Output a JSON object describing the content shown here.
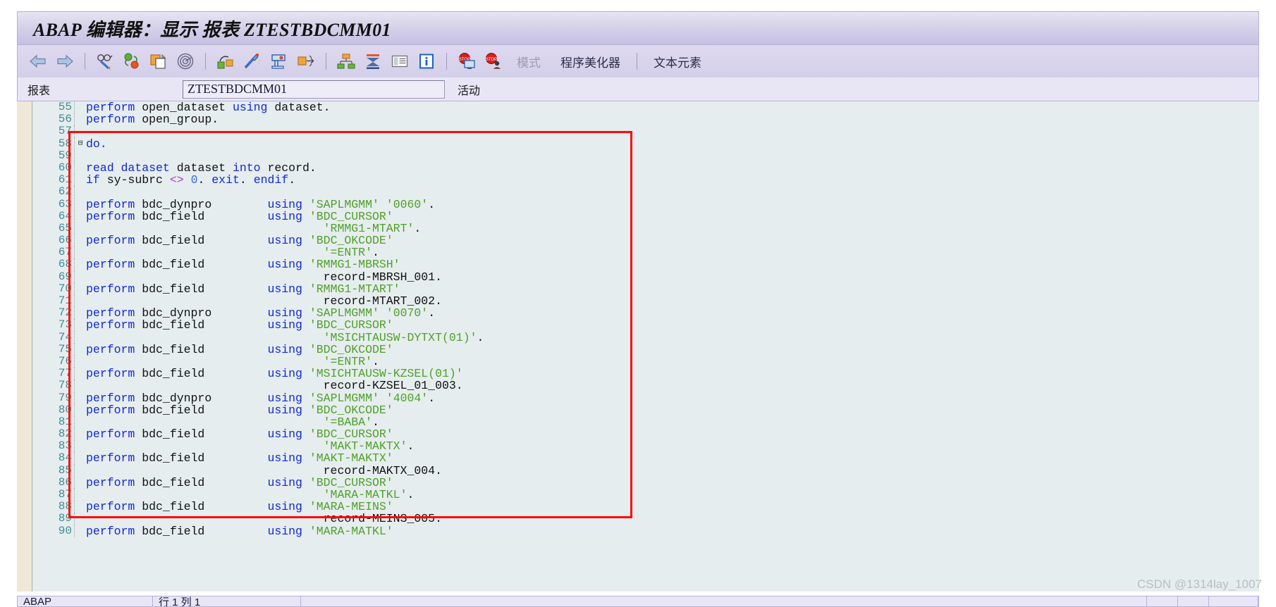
{
  "window": {
    "title": "ABAP 编辑器：显示 报表 ZTESTBDCMM01"
  },
  "toolbar": {
    "icons": [
      {
        "name": "back-arrow-icon",
        "label": "后退"
      },
      {
        "name": "forward-arrow-icon",
        "label": "前进"
      },
      {
        "name": "display-change-icon",
        "label": "显示<->修改"
      },
      {
        "name": "activate-icon",
        "label": "激活"
      },
      {
        "name": "copy-icon",
        "label": "复制"
      },
      {
        "name": "where-used-icon",
        "label": "使用位置"
      },
      {
        "name": "check-icon",
        "label": "检查"
      },
      {
        "name": "pretty-printer-icon",
        "label": "美化"
      },
      {
        "name": "pattern-icon",
        "label": "模式"
      },
      {
        "name": "insert-statement-icon",
        "label": "插入语句"
      },
      {
        "name": "object-navigator-icon",
        "label": "对象浏览器"
      },
      {
        "name": "stack-icon",
        "label": "堆栈"
      },
      {
        "name": "list-icon",
        "label": "列表"
      },
      {
        "name": "info-icon",
        "label": "信息"
      },
      {
        "name": "debug-screen-icon",
        "label": "调试"
      },
      {
        "name": "debug-user-icon",
        "label": "调试用户"
      }
    ],
    "mode_label": "模式",
    "pretty_printer_label": "程序美化器",
    "text_elements_label": "文本元素"
  },
  "report_row": {
    "label": "报表",
    "value": "ZTESTBDCMM01",
    "status": "活动"
  },
  "statusbar": {
    "language": "ABAP",
    "position": "行 1 列 1",
    "cell1": "",
    "cell2": "",
    "cell3": ""
  },
  "watermark": "CSDN @1314lay_1007",
  "editor": {
    "first_line": 55,
    "lines": [
      {
        "n": 55,
        "fold": "",
        "tokens": [
          {
            "t": "perform ",
            "c": "kw"
          },
          {
            "t": "open_dataset ",
            "c": "id"
          },
          {
            "t": "using ",
            "c": "kw"
          },
          {
            "t": "dataset.",
            "c": "id"
          }
        ]
      },
      {
        "n": 56,
        "fold": "",
        "tokens": [
          {
            "t": "perform ",
            "c": "kw"
          },
          {
            "t": "open_group.",
            "c": "id"
          }
        ]
      },
      {
        "n": 57,
        "fold": "",
        "tokens": []
      },
      {
        "n": 58,
        "fold": "⊟",
        "tokens": [
          {
            "t": "do.",
            "c": "kw"
          }
        ]
      },
      {
        "n": 59,
        "fold": "",
        "tokens": []
      },
      {
        "n": 60,
        "fold": "",
        "tokens": [
          {
            "t": "read dataset ",
            "c": "kw"
          },
          {
            "t": "dataset ",
            "c": "id"
          },
          {
            "t": "into ",
            "c": "kw"
          },
          {
            "t": "record.",
            "c": "id"
          }
        ]
      },
      {
        "n": 61,
        "fold": "",
        "tokens": [
          {
            "t": "if ",
            "c": "kw"
          },
          {
            "t": "sy-subrc ",
            "c": "id"
          },
          {
            "t": "<> ",
            "c": "op"
          },
          {
            "t": "0",
            "c": "num"
          },
          {
            "t": ". ",
            "c": "id"
          },
          {
            "t": "exit",
            "c": "kw"
          },
          {
            "t": ". ",
            "c": "id"
          },
          {
            "t": "endif",
            "c": "kw"
          },
          {
            "t": ".",
            "c": "id"
          }
        ]
      },
      {
        "n": 62,
        "fold": "",
        "tokens": []
      },
      {
        "n": 63,
        "fold": "",
        "tokens": [
          {
            "t": "perform ",
            "c": "kw"
          },
          {
            "t": "bdc_dynpro        ",
            "c": "id"
          },
          {
            "t": "using ",
            "c": "kw"
          },
          {
            "t": "'SAPLMGMM' '0060'",
            "c": "str"
          },
          {
            "t": ".",
            "c": "id"
          }
        ]
      },
      {
        "n": 64,
        "fold": "",
        "tokens": [
          {
            "t": "perform ",
            "c": "kw"
          },
          {
            "t": "bdc_field         ",
            "c": "id"
          },
          {
            "t": "using ",
            "c": "kw"
          },
          {
            "t": "'BDC_CURSOR'",
            "c": "str"
          }
        ]
      },
      {
        "n": 65,
        "fold": "",
        "tokens": [
          {
            "t": "                                  ",
            "c": "id"
          },
          {
            "t": "'RMMG1-MTART'",
            "c": "str"
          },
          {
            "t": ".",
            "c": "id"
          }
        ]
      },
      {
        "n": 66,
        "fold": "",
        "tokens": [
          {
            "t": "perform ",
            "c": "kw"
          },
          {
            "t": "bdc_field         ",
            "c": "id"
          },
          {
            "t": "using ",
            "c": "kw"
          },
          {
            "t": "'BDC_OKCODE'",
            "c": "str"
          }
        ]
      },
      {
        "n": 67,
        "fold": "",
        "tokens": [
          {
            "t": "                                  ",
            "c": "id"
          },
          {
            "t": "'=ENTR'",
            "c": "str"
          },
          {
            "t": ".",
            "c": "id"
          }
        ]
      },
      {
        "n": 68,
        "fold": "",
        "tokens": [
          {
            "t": "perform ",
            "c": "kw"
          },
          {
            "t": "bdc_field         ",
            "c": "id"
          },
          {
            "t": "using ",
            "c": "kw"
          },
          {
            "t": "'RMMG1-MBRSH'",
            "c": "str"
          }
        ]
      },
      {
        "n": 69,
        "fold": "",
        "tokens": [
          {
            "t": "                                  record-MBRSH_001.",
            "c": "id"
          }
        ]
      },
      {
        "n": 70,
        "fold": "",
        "tokens": [
          {
            "t": "perform ",
            "c": "kw"
          },
          {
            "t": "bdc_field         ",
            "c": "id"
          },
          {
            "t": "using ",
            "c": "kw"
          },
          {
            "t": "'RMMG1-MTART'",
            "c": "str"
          }
        ]
      },
      {
        "n": 71,
        "fold": "",
        "tokens": [
          {
            "t": "                                  record-MTART_002.",
            "c": "id"
          }
        ]
      },
      {
        "n": 72,
        "fold": "",
        "tokens": [
          {
            "t": "perform ",
            "c": "kw"
          },
          {
            "t": "bdc_dynpro        ",
            "c": "id"
          },
          {
            "t": "using ",
            "c": "kw"
          },
          {
            "t": "'SAPLMGMM' '0070'",
            "c": "str"
          },
          {
            "t": ".",
            "c": "id"
          }
        ]
      },
      {
        "n": 73,
        "fold": "",
        "tokens": [
          {
            "t": "perform ",
            "c": "kw"
          },
          {
            "t": "bdc_field         ",
            "c": "id"
          },
          {
            "t": "using ",
            "c": "kw"
          },
          {
            "t": "'BDC_CURSOR'",
            "c": "str"
          }
        ]
      },
      {
        "n": 74,
        "fold": "",
        "tokens": [
          {
            "t": "                                  ",
            "c": "id"
          },
          {
            "t": "'MSICHTAUSW-DYTXT(01)'",
            "c": "str"
          },
          {
            "t": ".",
            "c": "id"
          }
        ]
      },
      {
        "n": 75,
        "fold": "",
        "tokens": [
          {
            "t": "perform ",
            "c": "kw"
          },
          {
            "t": "bdc_field         ",
            "c": "id"
          },
          {
            "t": "using ",
            "c": "kw"
          },
          {
            "t": "'BDC_OKCODE'",
            "c": "str"
          }
        ]
      },
      {
        "n": 76,
        "fold": "",
        "tokens": [
          {
            "t": "                                  ",
            "c": "id"
          },
          {
            "t": "'=ENTR'",
            "c": "str"
          },
          {
            "t": ".",
            "c": "id"
          }
        ]
      },
      {
        "n": 77,
        "fold": "",
        "tokens": [
          {
            "t": "perform ",
            "c": "kw"
          },
          {
            "t": "bdc_field         ",
            "c": "id"
          },
          {
            "t": "using ",
            "c": "kw"
          },
          {
            "t": "'MSICHTAUSW-KZSEL(01)'",
            "c": "str"
          }
        ]
      },
      {
        "n": 78,
        "fold": "",
        "tokens": [
          {
            "t": "                                  record-KZSEL_01_003.",
            "c": "id"
          }
        ]
      },
      {
        "n": 79,
        "fold": "",
        "tokens": [
          {
            "t": "perform ",
            "c": "kw"
          },
          {
            "t": "bdc_dynpro        ",
            "c": "id"
          },
          {
            "t": "using ",
            "c": "kw"
          },
          {
            "t": "'SAPLMGMM' '4004'",
            "c": "str"
          },
          {
            "t": ".",
            "c": "id"
          }
        ]
      },
      {
        "n": 80,
        "fold": "",
        "tokens": [
          {
            "t": "perform ",
            "c": "kw"
          },
          {
            "t": "bdc_field         ",
            "c": "id"
          },
          {
            "t": "using ",
            "c": "kw"
          },
          {
            "t": "'BDC_OKCODE'",
            "c": "str"
          }
        ]
      },
      {
        "n": 81,
        "fold": "",
        "tokens": [
          {
            "t": "                                  ",
            "c": "id"
          },
          {
            "t": "'=BABA'",
            "c": "str"
          },
          {
            "t": ".",
            "c": "id"
          }
        ]
      },
      {
        "n": 82,
        "fold": "",
        "tokens": [
          {
            "t": "perform ",
            "c": "kw"
          },
          {
            "t": "bdc_field         ",
            "c": "id"
          },
          {
            "t": "using ",
            "c": "kw"
          },
          {
            "t": "'BDC_CURSOR'",
            "c": "str"
          }
        ]
      },
      {
        "n": 83,
        "fold": "",
        "tokens": [
          {
            "t": "                                  ",
            "c": "id"
          },
          {
            "t": "'MAKT-MAKTX'",
            "c": "str"
          },
          {
            "t": ".",
            "c": "id"
          }
        ]
      },
      {
        "n": 84,
        "fold": "",
        "tokens": [
          {
            "t": "perform ",
            "c": "kw"
          },
          {
            "t": "bdc_field         ",
            "c": "id"
          },
          {
            "t": "using ",
            "c": "kw"
          },
          {
            "t": "'MAKT-MAKTX'",
            "c": "str"
          }
        ]
      },
      {
        "n": 85,
        "fold": "",
        "tokens": [
          {
            "t": "                                  record-MAKTX_004.",
            "c": "id"
          }
        ]
      },
      {
        "n": 86,
        "fold": "",
        "tokens": [
          {
            "t": "perform ",
            "c": "kw"
          },
          {
            "t": "bdc_field         ",
            "c": "id"
          },
          {
            "t": "using ",
            "c": "kw"
          },
          {
            "t": "'BDC_CURSOR'",
            "c": "str"
          }
        ]
      },
      {
        "n": 87,
        "fold": "",
        "tokens": [
          {
            "t": "                                  ",
            "c": "id"
          },
          {
            "t": "'MARA-MATKL'",
            "c": "str"
          },
          {
            "t": ".",
            "c": "id"
          }
        ]
      },
      {
        "n": 88,
        "fold": "",
        "tokens": [
          {
            "t": "perform ",
            "c": "kw"
          },
          {
            "t": "bdc_field         ",
            "c": "id"
          },
          {
            "t": "using ",
            "c": "kw"
          },
          {
            "t": "'MARA-MEINS'",
            "c": "str"
          }
        ]
      },
      {
        "n": 89,
        "fold": "",
        "tokens": [
          {
            "t": "                                  record-MEINS_005.",
            "c": "id"
          }
        ]
      },
      {
        "n": 90,
        "fold": "",
        "tokens": [
          {
            "t": "perform ",
            "c": "kw"
          },
          {
            "t": "bdc_field         ",
            "c": "id"
          },
          {
            "t": "using ",
            "c": "kw"
          },
          {
            "t": "'MARA-MATKL'",
            "c": "str"
          }
        ]
      }
    ]
  }
}
